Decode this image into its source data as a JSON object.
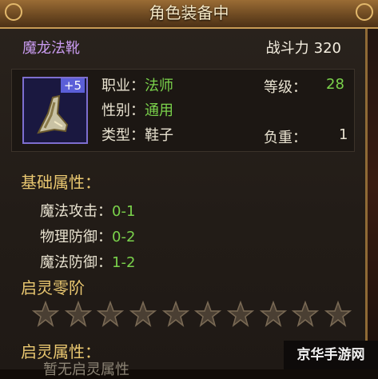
{
  "header": {
    "title": "角色装备中"
  },
  "item": {
    "name": "魔龙法靴",
    "power_label": "战斗力",
    "power_value": "320",
    "enhance": "+5",
    "job_label": "职业：",
    "job_value": "法师",
    "gender_label": "性别：",
    "gender_value": "通用",
    "type_label": "类型：",
    "type_value": "鞋子",
    "level_label": "等级：",
    "level_value": "28",
    "weight_label": "负重：",
    "weight_value": "1"
  },
  "base": {
    "title": "基础属性：",
    "stats": [
      {
        "label": "魔法攻击：",
        "value": "0-1"
      },
      {
        "label": "物理防御：",
        "value": "0-2"
      },
      {
        "label": "魔法防御：",
        "value": "1-2"
      }
    ]
  },
  "awaken": {
    "rank_title": "启灵零阶",
    "star_count": 10,
    "stars_lit": 0,
    "attr_title": "启灵属性：",
    "locked_text": "暂无启灵属性"
  },
  "watermark": "京华手游网",
  "colors": {
    "accent_green": "#7ad24b",
    "name_purple": "#c99bf0",
    "section_gold": "#e9c770"
  }
}
